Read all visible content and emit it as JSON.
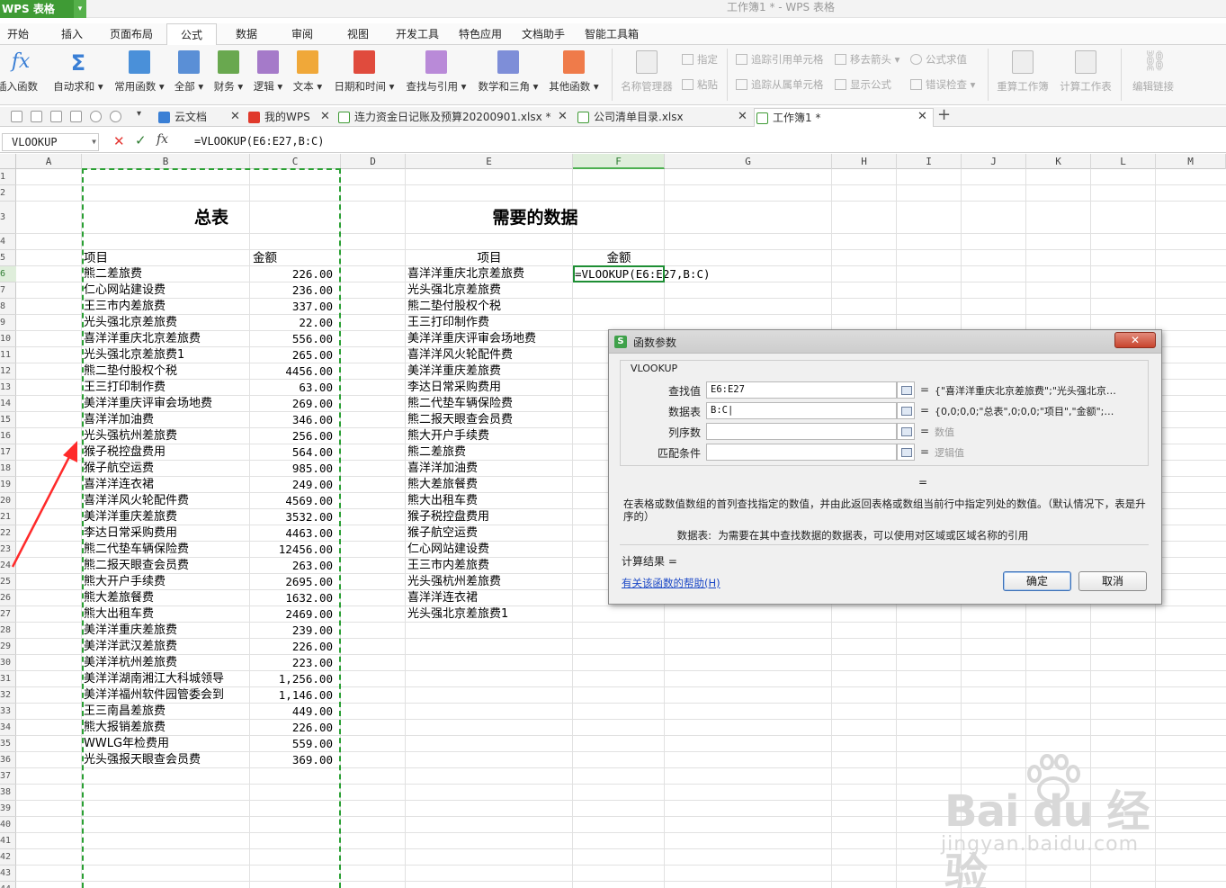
{
  "app": {
    "name": "WPS 表格",
    "window_title": "工作簿1 * - WPS 表格"
  },
  "ribbon_tabs": [
    "开始",
    "插入",
    "页面布局",
    "公式",
    "数据",
    "审阅",
    "视图",
    "开发工具",
    "特色应用",
    "文档助手",
    "智能工具箱"
  ],
  "active_ribbon_tab": "公式",
  "ribbon": {
    "insert_fn": "插入函数",
    "autosum": "自动求和 ▾",
    "common": "常用函数 ▾",
    "all": "全部 ▾",
    "finance": "财务 ▾",
    "logic": "逻辑 ▾",
    "text": "文本 ▾",
    "datetime": "日期和时间 ▾",
    "lookup": "查找与引用 ▾",
    "math": "数学和三角 ▾",
    "other": "其他函数 ▾",
    "name_mgr": "名称管理器",
    "define": "指定",
    "paste": "粘贴",
    "trace_prec": "追踪引用单元格",
    "trace_dep": "追踪从属单元格",
    "remove_arrows": "移去箭头 ▾",
    "show_formula": "显示公式",
    "eval_formula": "公式求值",
    "error_check": "错误检查 ▾",
    "recalc_wb": "重算工作簿",
    "calc_sheet": "计算工作表",
    "edit_links": "编辑链接"
  },
  "doc_tabs": [
    {
      "label": "云文档",
      "icon": "cloud-icon",
      "active": false
    },
    {
      "label": "我的WPS",
      "icon": "wps-icon",
      "active": false
    },
    {
      "label": "连力资金日记账及预算20200901.xlsx *",
      "icon": "sheet-icon",
      "active": false
    },
    {
      "label": "公司清单目录.xlsx",
      "icon": "sheet-icon",
      "active": false
    },
    {
      "label": "工作簿1 *",
      "icon": "sheet-icon",
      "active": true
    }
  ],
  "formula_bar": {
    "name_box": "VLOOKUP",
    "fx": "fx",
    "formula": "=VLOOKUP(E6:E27,B:C)"
  },
  "columns": [
    "A",
    "B",
    "C",
    "D",
    "E",
    "F",
    "G",
    "H",
    "I",
    "J",
    "K",
    "L",
    "M"
  ],
  "active_col": "F",
  "active_row": "6",
  "rows": [
    "1",
    "2",
    "3",
    "4",
    "5",
    "6",
    "7",
    "8",
    "9",
    "10",
    "11",
    "12",
    "13",
    "14",
    "15",
    "16",
    "17",
    "18",
    "19",
    "20",
    "21",
    "22",
    "23",
    "24",
    "25",
    "26",
    "27",
    "28",
    "29",
    "30",
    "31",
    "32",
    "33",
    "34",
    "35",
    "36",
    "37",
    "38",
    "39",
    "40",
    "41",
    "42",
    "43",
    "44"
  ],
  "sheet": {
    "summary_title": "总表",
    "needed_title": "需要的数据",
    "b5": "项目",
    "c5": "金额",
    "e5": "项目",
    "f5": "金额",
    "f6_formula": "=VLOOKUP(E6:E27,B:C)",
    "summary": [
      {
        "item": "熊二差旅费",
        "amount": "226.00"
      },
      {
        "item": "仁心网站建设费",
        "amount": "236.00"
      },
      {
        "item": "王三市内差旅费",
        "amount": "337.00"
      },
      {
        "item": "光头强北京差旅费",
        "amount": "22.00"
      },
      {
        "item": "喜洋洋重庆北京差旅费",
        "amount": "556.00"
      },
      {
        "item": "光头强北京差旅费1",
        "amount": "265.00"
      },
      {
        "item": "熊二垫付股权个税",
        "amount": "4456.00"
      },
      {
        "item": "王三打印制作费",
        "amount": "63.00"
      },
      {
        "item": "美洋洋重庆评审会场地费",
        "amount": "269.00"
      },
      {
        "item": "喜洋洋加油费",
        "amount": "346.00"
      },
      {
        "item": "光头强杭州差旅费",
        "amount": "256.00"
      },
      {
        "item": "猴子税控盘费用",
        "amount": "564.00"
      },
      {
        "item": "猴子航空运费",
        "amount": "985.00"
      },
      {
        "item": "喜洋洋连衣裙",
        "amount": "249.00"
      },
      {
        "item": "喜洋洋风火轮配件费",
        "amount": "4569.00"
      },
      {
        "item": "美洋洋重庆差旅费",
        "amount": "3532.00"
      },
      {
        "item": "李达日常采购费用",
        "amount": "4463.00"
      },
      {
        "item": "熊二代垫车辆保险费",
        "amount": "12456.00"
      },
      {
        "item": "熊二报天眼查会员费",
        "amount": "263.00"
      },
      {
        "item": "熊大开户手续费",
        "amount": "2695.00"
      },
      {
        "item": "熊大差旅餐费",
        "amount": "1632.00"
      },
      {
        "item": "熊大出租车费",
        "amount": "2469.00"
      },
      {
        "item": "美洋洋重庆差旅费",
        "amount": "239.00"
      },
      {
        "item": "美洋洋武汉差旅费",
        "amount": "226.00"
      },
      {
        "item": "美洋洋杭州差旅费",
        "amount": "223.00"
      },
      {
        "item": "美洋洋湖南湘江大科城领导",
        "amount": "1,256.00"
      },
      {
        "item": "美洋洋福州软件园管委会到",
        "amount": "1,146.00"
      },
      {
        "item": "王三南昌差旅费",
        "amount": "449.00"
      },
      {
        "item": "熊大报销差旅费",
        "amount": "226.00"
      },
      {
        "item": "WWLG年检费用",
        "amount": "559.00"
      },
      {
        "item": "光头强报天眼查会员费",
        "amount": "369.00"
      }
    ],
    "needed": [
      "喜洋洋重庆北京差旅费",
      "光头强北京差旅费",
      "熊二垫付股权个税",
      "王三打印制作费",
      "美洋洋重庆评审会场地费",
      "喜洋洋风火轮配件费",
      "美洋洋重庆差旅费",
      "李达日常采购费用",
      "熊二代垫车辆保险费",
      "熊二报天眼查会员费",
      "熊大开户手续费",
      "熊二差旅费",
      "喜洋洋加油费",
      "熊大差旅餐费",
      "熊大出租车费",
      "猴子税控盘费用",
      "猴子航空运费",
      "仁心网站建设费",
      "王三市内差旅费",
      "光头强杭州差旅费",
      "喜洋洋连衣裙",
      "光头强北京差旅费1"
    ]
  },
  "dialog": {
    "title": "函数参数",
    "close": "✕",
    "function": "VLOOKUP",
    "args": [
      {
        "label": "查找值",
        "value": "E6:E27",
        "result": "{\"喜洋洋重庆北京差旅费\";\"光头强北京…",
        "grey": false
      },
      {
        "label": "数据表",
        "value": "B:C|",
        "result": "{0,0;0,0;\"总表\",0;0,0;\"项目\",\"金额\";…",
        "grey": false
      },
      {
        "label": "列序数",
        "value": "",
        "result": "数值",
        "grey": true
      },
      {
        "label": "匹配条件",
        "value": "",
        "result": "逻辑值",
        "grey": true
      }
    ],
    "equals": "=",
    "description": "在表格或数值数组的首列查找指定的数值，并由此返回表格或数组当前行中指定列处的数值。（默认情况下，表是升序的）",
    "arg_desc_name": "数据表:",
    "arg_desc_text": "为需要在其中查找数据的数据表，可以使用对区域或区域名称的引用",
    "result_label": "计算结果 =",
    "help_link": "有关该函数的帮助(H)",
    "ok": "确定",
    "cancel": "取消"
  },
  "watermark": {
    "line1": "Bai du 经验",
    "line2": "jingyan.baidu.com"
  },
  "colors": {
    "accent_green": "#3f9b35",
    "copy_border": "#2aa033",
    "arrow": "#ff2a2a",
    "link": "#1a47c6"
  }
}
